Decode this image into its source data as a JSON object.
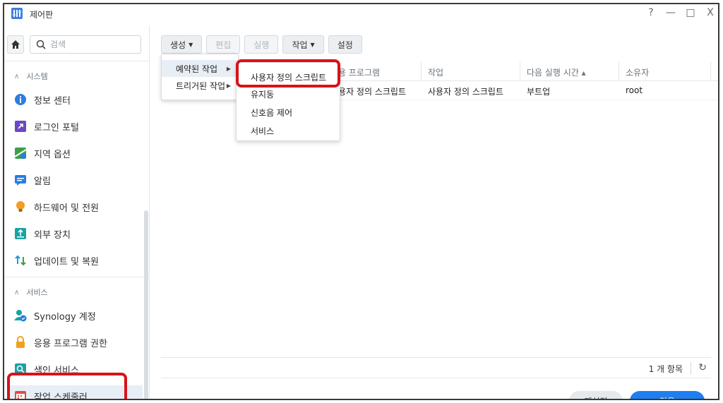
{
  "window": {
    "title": "제어판",
    "controls": [
      "?",
      "—",
      "□",
      "X"
    ]
  },
  "sidebar": {
    "search_placeholder": "검색",
    "sections": [
      {
        "label": "시스템"
      },
      {
        "label": "서비스"
      }
    ],
    "items": [
      {
        "label": "정보 센터",
        "icon": "info-icon",
        "color": "#2a7de1"
      },
      {
        "label": "로그인 포털",
        "icon": "portal-icon",
        "color": "#6b47c9"
      },
      {
        "label": "지역 옵션",
        "icon": "map-icon",
        "color": "#3aa14a"
      },
      {
        "label": "알림",
        "icon": "notification-icon",
        "color": "#2a7de1"
      },
      {
        "label": "하드웨어 및 전원",
        "icon": "bulb-icon",
        "color": "#f39c24"
      },
      {
        "label": "외부 장치",
        "icon": "external-device-icon",
        "color": "#1aa3a3"
      },
      {
        "label": "업데이트 및 복원",
        "icon": "update-icon",
        "color": "#1f9ad6"
      },
      {
        "label": "Synology 계정",
        "icon": "account-icon",
        "color": "#2a7de1"
      },
      {
        "label": "응용 프로그램 권한",
        "icon": "lock-icon",
        "color": "#f0a21c"
      },
      {
        "label": "색인 서비스",
        "icon": "index-icon",
        "color": "#1aa3a3"
      },
      {
        "label": "작업 스케줄러",
        "icon": "calendar-icon",
        "color": "#e24b4b"
      }
    ]
  },
  "toolbar": {
    "create": "생성",
    "edit": "편집",
    "run": "실행",
    "action": "작업",
    "settings": "설정"
  },
  "grid": {
    "headers": [
      "응용 프로그램",
      "작업",
      "다음 실행 시간 ▴",
      "소유자"
    ],
    "rows": [
      {
        "app": "사용자 정의 스크립트",
        "task": "사용자 정의 스크립트",
        "next": "부트업",
        "owner": "root"
      }
    ]
  },
  "menu_create": {
    "items": [
      "예약된 작업",
      "트리거된 작업"
    ]
  },
  "menu_sub": {
    "items": [
      "사용자 정의 스크립트",
      "유지동",
      "신호음 제어",
      "서비스"
    ]
  },
  "footer": {
    "count": "1 개 항목"
  },
  "buttons": {
    "reset": "재설정",
    "apply": "적용"
  },
  "colors": {
    "accent": "#1f7ef0",
    "highlight": "#d7131b"
  }
}
